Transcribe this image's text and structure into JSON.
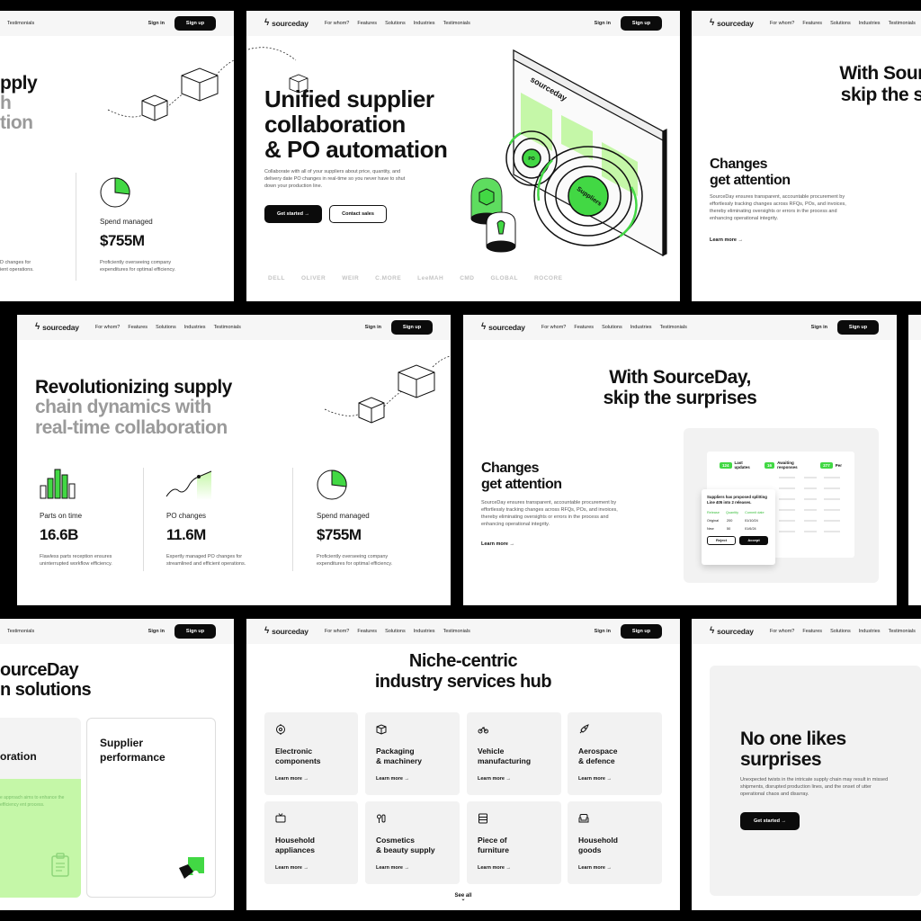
{
  "brand": {
    "name": "sourceday",
    "green": "#42d844",
    "lime": "#c5f7a8",
    "dark": "#0b0b0b"
  },
  "nav": {
    "links": [
      "For whom?",
      "Features",
      "Solutions",
      "Industries",
      "Testimonials"
    ],
    "testimonials": "Testimonials",
    "sign_in": "Sign in",
    "sign_up": "Sign up"
  },
  "hero": {
    "line1": "Unified supplier",
    "line2": "collaboration",
    "line3": "& PO automation",
    "description": "Collaborate with all of your suppliers about price, quantity, and delivery date PO changes in real-time so you never have to shut down your production line.",
    "get_started": "Get started",
    "contact_sales": "Contact sales",
    "illustration_brand": "sourceday",
    "node_small": "PO",
    "node_large": "Suppliers",
    "partner_logos": [
      "DELL",
      "OLIVER",
      "WEIR",
      "C.MORE",
      "LeeMAH",
      "CMD",
      "GLOBAL",
      "ROCORE"
    ]
  },
  "revolution": {
    "line1": "Revolutionizing supply",
    "line2": "chain dynamics with",
    "line3": "real-time collaboration",
    "crop_line1": "pply",
    "crop_line2": "h",
    "crop_line3": "tion",
    "stats": [
      {
        "label": "Parts on time",
        "value": "16.6B",
        "desc": "Flawless parts reception ensures uninterrupted workflow efficiency."
      },
      {
        "label": "PO changes",
        "value": "11.6M",
        "desc": "Expertly managed PO changes for streamlined and efficient operations."
      },
      {
        "label": "Spend managed",
        "value": "$755M",
        "desc": "Proficiently overseeing company expenditures for optimal efficiency."
      }
    ],
    "crop_desc": "D changes for",
    "crop_desc2": "ient operations."
  },
  "surprises": {
    "title1": "With SourceDay,",
    "title2": "skip the surprises",
    "crop_title1": "With Sourc",
    "crop_title2": "skip the su",
    "sub1": "Changes",
    "sub2": "get attention",
    "description": "SourceDay ensures transparent, accountable procurement by effortlessly tracking changes across RFQs, POs, and invoices, thereby eliminating oversights or errors in the process and enhancing operational integrity.",
    "learn_more": "Learn more",
    "tabs": [
      {
        "count": "124",
        "label": "Last updates"
      },
      {
        "count": "16",
        "label": "Awaiting responses"
      },
      {
        "count": "277",
        "label": "Per"
      }
    ],
    "popup": {
      "title": "Suppliers has proposed splitting Line 405 into 2 releases.",
      "cols": [
        "Release",
        "Quantity",
        "Commit date"
      ],
      "rows": [
        [
          "Original",
          "200",
          "01/10/24"
        ],
        [
          "New",
          "50",
          "01/6/24"
        ]
      ],
      "reject": "Reject",
      "accept": "Accept"
    }
  },
  "solutions": {
    "title1": "ourceDay",
    "title2": "n solutions",
    "card1": "oration",
    "card1_text": "e approach aims to enhance the efficiency ent process.",
    "card2_line1": "Supplier",
    "card2_line2": "performance"
  },
  "industries": {
    "title1": "Niche-centric",
    "title2": "industry services hub",
    "learn_more": "Learn more",
    "see_all": "See all",
    "items": [
      {
        "l1": "Electronic",
        "l2": "components",
        "icon": "chip-icon"
      },
      {
        "l1": "Packaging",
        "l2": "& machinery",
        "icon": "box-icon"
      },
      {
        "l1": "Vehicle",
        "l2": "manufacturing",
        "icon": "car-icon"
      },
      {
        "l1": "Aerospace",
        "l2": "& defence",
        "icon": "rocket-icon"
      },
      {
        "l1": "Household",
        "l2": "appliances",
        "icon": "tv-icon"
      },
      {
        "l1": "Cosmetics",
        "l2": "& beauty supply",
        "icon": "cosmetics-icon"
      },
      {
        "l1": "Piece of",
        "l2": "furniture",
        "icon": "cabinet-icon"
      },
      {
        "l1": "Household",
        "l2": "goods",
        "icon": "sofa-icon"
      }
    ]
  },
  "no_surprises": {
    "line1": "No one likes",
    "line2": "surprises",
    "description": "Unexpected twists in the intricate supply chain may result in missed shipments, disrupted production lines, and the onset of utter operational chaos and disarray.",
    "cta": "Get started"
  }
}
